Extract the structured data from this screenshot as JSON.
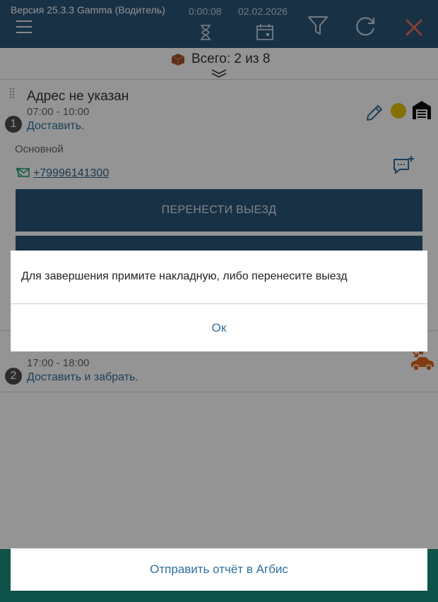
{
  "header": {
    "version": "Версия 25.3.3 Gamma (Водитель)",
    "timer": "0:00:08",
    "date": "02.02.2026"
  },
  "summary": {
    "text": "Всего: 2 из 8"
  },
  "orders": [
    {
      "number": "1",
      "title": "Адрес не указан",
      "time": "07:00 - 10:00",
      "action": "Доставить.",
      "status_color": "#e6c20b",
      "contact_type": "Основной",
      "phone": "+79996141300",
      "reschedule_label": "ПЕРЕНЕСТИ ВЫЕЗД"
    },
    {
      "number": "2",
      "title": "",
      "time": "17:00 - 18:00",
      "action": "Доставить и забрать."
    }
  ],
  "dialog": {
    "message": "Для завершения примите накладную, либо перенесите выезд",
    "ok_label": "Ок"
  },
  "send_report_label": "Отправить отчёт в Агбис",
  "colors": {
    "primary": "#2a5578",
    "accent_text": "#2e6f9c",
    "bottom_bar": "#1b8e7f",
    "delivery_icon": "#e0641c"
  },
  "icons": [
    "menu-icon",
    "hourglass-icon",
    "calendar-icon",
    "filter-icon",
    "refresh-icon",
    "close-icon",
    "box-icon",
    "expand-icon",
    "pencil-icon",
    "warehouse-icon",
    "phone-icon",
    "comment-add-icon",
    "delivery-car-icon"
  ]
}
